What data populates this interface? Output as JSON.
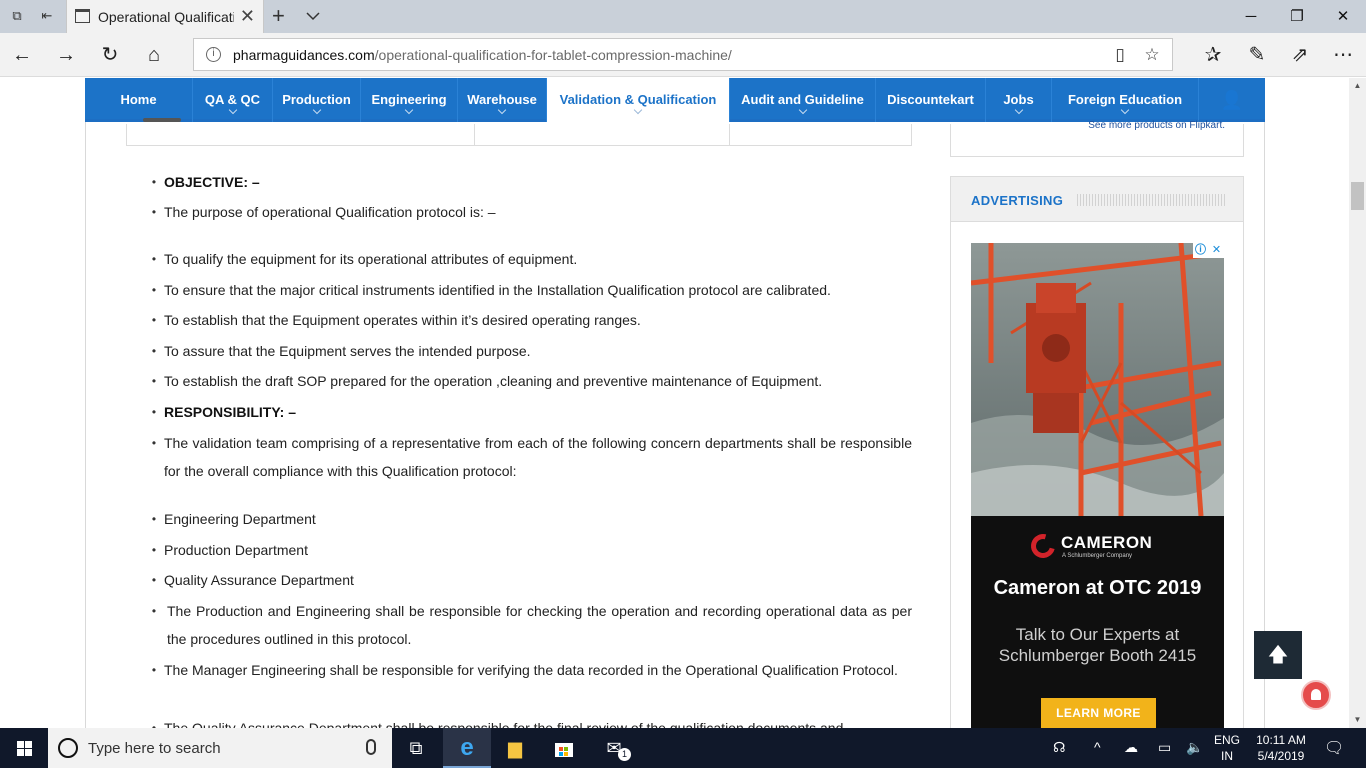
{
  "browser": {
    "tab_title": "Operational Qualification for Tablet Compression Machine",
    "url_host": "pharmaguidances.com",
    "url_path": "/operational-qualification-for-tablet-compression-machine/"
  },
  "site_nav": {
    "items": [
      {
        "label": "Home",
        "has_dropdown": false
      },
      {
        "label": "QA & QC",
        "has_dropdown": true
      },
      {
        "label": "Production",
        "has_dropdown": true
      },
      {
        "label": "Engineering",
        "has_dropdown": true
      },
      {
        "label": "Warehouse",
        "has_dropdown": true
      },
      {
        "label": "Validation & Qualification",
        "has_dropdown": true,
        "active": true
      },
      {
        "label": "Audit and Guideline",
        "has_dropdown": true
      },
      {
        "label": "Discountekart",
        "has_dropdown": false
      },
      {
        "label": "Jobs",
        "has_dropdown": true
      },
      {
        "label": "Foreign Education",
        "has_dropdown": true
      }
    ],
    "accent_color": "#1c73c8"
  },
  "article": {
    "objective_heading": "OBJECTIVE: –",
    "objective_intro": "The purpose of operational Qualification protocol is: –",
    "objectives": [
      "To qualify the equipment for its operational attributes of equipment.",
      "To ensure that the major critical instruments identified in the Installation Qualification protocol are calibrated.",
      "To establish that the Equipment operates within it’s desired operating ranges.",
      "To assure that the Equipment serves the intended purpose.",
      "To establish the draft SOP prepared for the operation ,cleaning and preventive maintenance of Equipment."
    ],
    "responsibility_heading": "RESPONSIBILITY: –",
    "responsibility_intro": "The validation team comprising of a representative from each of the following concern departments shall be responsible for the overall compliance with this Qualification protocol:",
    "departments": [
      "Engineering Department",
      "Production Department",
      "Quality Assurance Department"
    ],
    "duties": [
      "The Production and Engineering shall be responsible for checking the operation and recording operational data as per the procedures outlined in this protocol.",
      "The Manager Engineering shall be responsible for verifying the data recorded in the Operational Qualification Protocol.",
      "The Quality Assurance Department shall be responsible for the final review of the qualification documents and"
    ]
  },
  "sidebar": {
    "flipkart_link": "See more products on Flipkart.",
    "ad_section_title": "ADVERTISING",
    "ad": {
      "brand": "CAMERON",
      "brand_sub": "A Schlumberger Company",
      "headline": "Cameron at OTC 2019",
      "body_line1": "Talk to Our Experts at",
      "body_line2": "Schlumberger Booth 2415",
      "cta": "LEARN MORE",
      "cta_color": "#f2b31a"
    }
  },
  "taskbar": {
    "search_placeholder": "Type here to search",
    "language": "ENG",
    "region": "IN",
    "time": "10:11 AM",
    "date": "5/4/2019",
    "mail_badge": "1"
  }
}
